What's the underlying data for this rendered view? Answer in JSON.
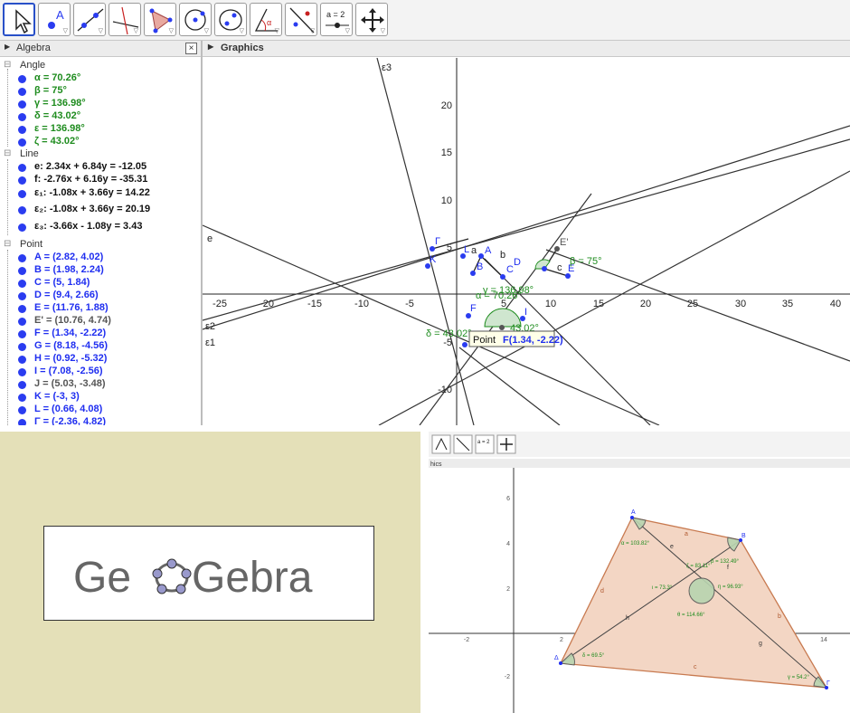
{
  "toolbar": {
    "tools": [
      "move-tool-icon",
      "point-tool-icon",
      "line-tool-icon",
      "perpendicular-line-tool-icon",
      "polygon-tool-icon",
      "circle-tool-icon",
      "conic-tool-icon",
      "angle-tool-icon",
      "reflect-tool-icon",
      "slider-tool-icon",
      "move-graphics-tool-icon"
    ],
    "slider_label": "a = 2"
  },
  "algebra": {
    "title": "Algebra",
    "close": "×",
    "categories": {
      "angle": "Angle",
      "line": "Line",
      "point": "Point"
    },
    "angles": [
      "α = 70.26°",
      "β = 75°",
      "γ = 136.98°",
      "δ = 43.02°",
      "ε = 136.98°",
      "ζ = 43.02°"
    ],
    "lines": [
      "e: 2.34x + 6.84y = -12.05",
      "f: -2.76x + 6.16y = -35.31",
      "ε₁: -1.08x + 3.66y = 14.22",
      "ε₂: -1.08x + 3.66y = 20.19",
      "ε₃: -3.66x - 1.08y = 3.43"
    ],
    "points": [
      "A = (2.82, 4.02)",
      "B = (1.98, 2.24)",
      "C = (5, 1.84)",
      "D = (9.4, 2.66)",
      "E = (11.76, 1.88)",
      "E' = (10.76, 4.74)",
      "F = (1.34, -2.22)",
      "G = (8.18, -4.56)",
      "H = (0.92, -5.32)",
      "I = (7.08, -2.56)",
      "J = (5.03, -3.48)",
      "K = (-3, 3)",
      "L = (0.66, 4.08)",
      "Γ = (-2.36, 4.82)"
    ]
  },
  "graphics": {
    "title": "Graphics",
    "x_ticks": [
      "-25",
      "-20",
      "-15",
      "-10",
      "-5",
      "5",
      "10",
      "15",
      "20",
      "25",
      "30",
      "35",
      "40"
    ],
    "y_ticks": [
      "20",
      "15",
      "10",
      "5",
      "-5",
      "-10"
    ],
    "line_labels": {
      "e": "e",
      "eps1": "ε1",
      "eps2": "ε2",
      "eps3": "ε3"
    },
    "point_labels": [
      "A",
      "B",
      "C",
      "D",
      "E",
      "E'",
      "F",
      "I",
      "K",
      "L",
      "Γ",
      "a",
      "b",
      "c",
      "f"
    ],
    "angle_labels": {
      "alpha": "α = 70.26°",
      "beta": "β = 75°",
      "gamma": "γ = 136.98°",
      "delta": "δ = 43.02°",
      "zeta": "43.02°"
    },
    "tooltip_prefix": "Point ",
    "tooltip_value": "F(1.34, -2.22)"
  },
  "logo": {
    "text_left": "Ge",
    "text_right": "Gebra"
  },
  "screenshot2": {
    "tab_label": "hics",
    "slider_label": "a = 2",
    "x_ticks": [
      "-2",
      "2",
      "4",
      "6",
      "8",
      "10",
      "12",
      "14"
    ],
    "y_ticks": [
      "6",
      "4",
      "2",
      "-2"
    ],
    "vertex_labels": [
      "A",
      "B",
      "Γ",
      "Δ"
    ],
    "side_labels": [
      "a",
      "b",
      "c",
      "d",
      "e",
      "f",
      "g",
      "h"
    ],
    "angle_labels": [
      "α = 103.82°",
      "β = 132.49°",
      "γ = 54.2°",
      "δ = 69.5°",
      "ζ = 83.11°",
      "η = 96.93°",
      "θ = 114.66°",
      "ι = 73.3°"
    ]
  },
  "colors": {
    "angle_green": "#1e8c1e",
    "point_blue": "#1f2ef0",
    "polygon_fill": "#f3d6c4",
    "polygon_stroke": "#c87a50",
    "logo_panel": "#e4e0b8"
  }
}
